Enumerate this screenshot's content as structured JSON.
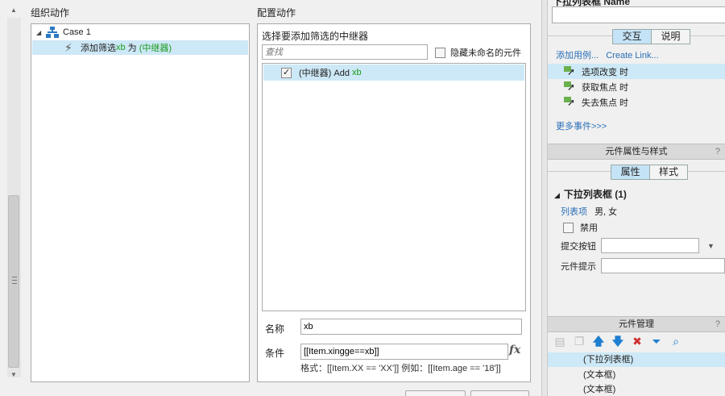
{
  "organize": {
    "title": "组织动作",
    "case_label": "Case 1",
    "action": {
      "prefix": "添加筛选 ",
      "var": "xb",
      "mid": " 为 ",
      "target": "(中继器)"
    }
  },
  "configure": {
    "title": "配置动作",
    "select_label": "选择要添加筛选的中继器",
    "search_placeholder": "查找",
    "hide_unnamed": "隐藏未命名的元件",
    "repeater": {
      "name": "(中继器) Add ",
      "var": "xb",
      "checked": true
    },
    "name_label": "名称",
    "name_value": "xb",
    "condition_label": "条件",
    "condition_value": "[[Item.xingge==xb]]",
    "fx_label": "fx",
    "hint": "格式：[[Item.XX == 'XX']] 例如：[[Item.age == '18']]"
  },
  "right": {
    "top_label": "下拉列表框 Name",
    "tabs1": {
      "active": "交互",
      "inactive": "说明"
    },
    "links": {
      "add_case": "添加用例...",
      "create_link": "Create Link..."
    },
    "events": [
      "选项改变 时",
      "获取焦点 时",
      "失去焦点 时"
    ],
    "more_events": "更多事件>>>",
    "props_header": "元件属性与样式",
    "help": "?",
    "tabs2": {
      "active": "属性",
      "inactive": "样式"
    },
    "dropdown_title": "下拉列表框 (1)",
    "list_key": "列表项",
    "list_value": "男, 女",
    "disabled_label": "禁用",
    "submit_label": "提交按钮",
    "tooltip_label": "元件提示",
    "manager_header": "元件管理",
    "widgets": [
      "(下拉列表框)",
      "(文本框)",
      "(文本框)"
    ]
  },
  "colors": {
    "accent_green": "#1a9c1a",
    "selection": "#cde8f6",
    "link": "#2a6fb7"
  }
}
